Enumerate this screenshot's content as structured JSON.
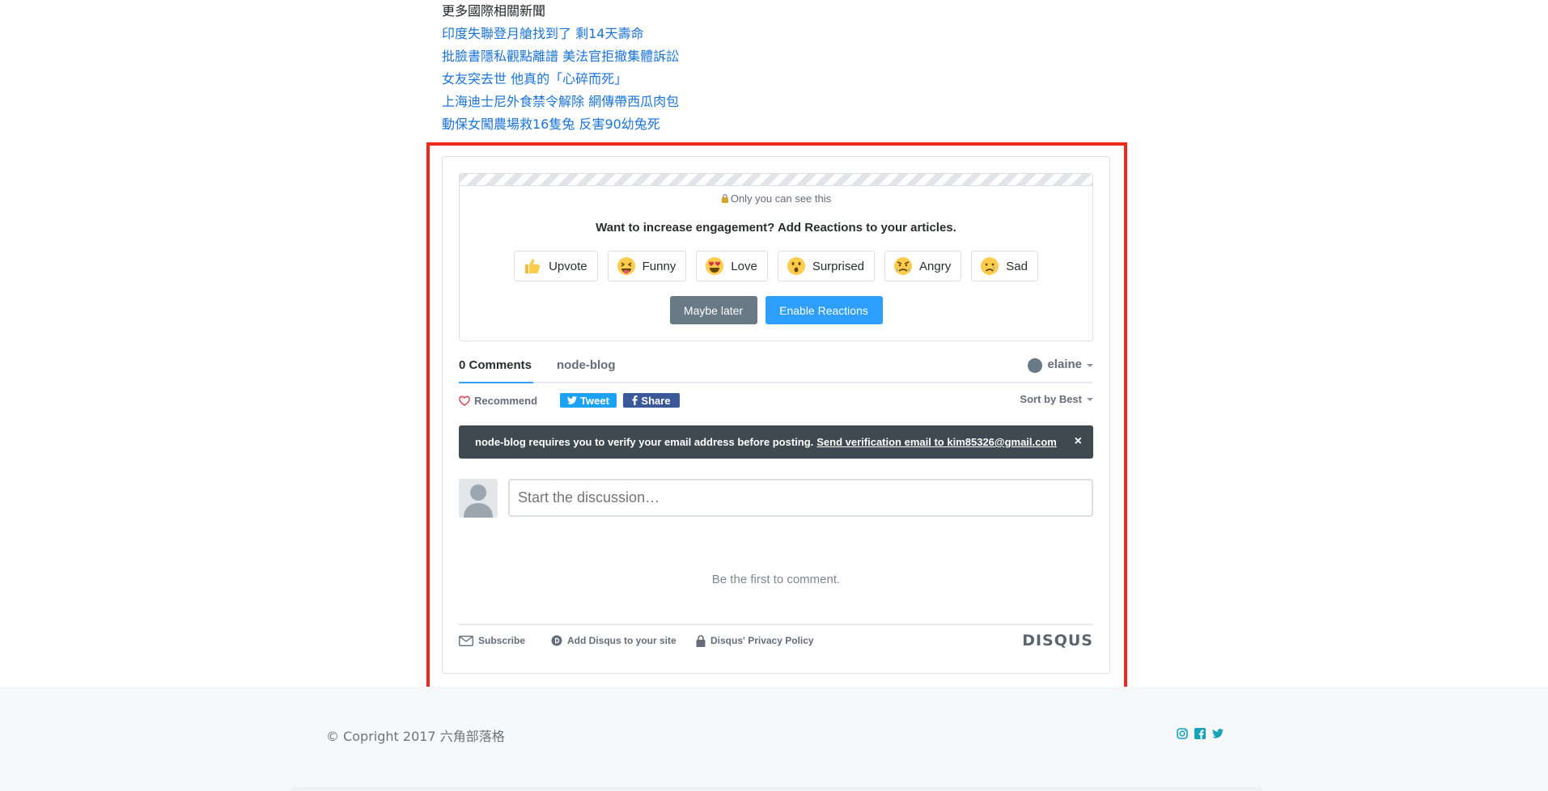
{
  "related": {
    "heading": "更多國際相關新聞",
    "links": [
      "印度失聯登月艙找到了 剩14天壽命",
      "批臉書隱私觀點離譜 美法官拒撤集體訴訟",
      "女友突去世 他真的「心碎而死」",
      "上海迪士尼外食禁令解除 網傳帶西瓜肉包",
      "動保女闖農場救16隻兔 反害90幼兔死"
    ]
  },
  "promo": {
    "only_you": "Only you can see this",
    "title": "Want to increase engagement? Add Reactions to your articles.",
    "reactions": [
      "Upvote",
      "Funny",
      "Love",
      "Surprised",
      "Angry",
      "Sad"
    ],
    "maybe_later": "Maybe later",
    "enable": "Enable Reactions"
  },
  "tabs": {
    "comments": "0 Comments",
    "forum": "node-blog",
    "user": "elaine"
  },
  "actions": {
    "recommend": "Recommend",
    "tweet": "Tweet",
    "share": "Share",
    "sort": "Sort by Best"
  },
  "notice": {
    "text": "node-blog requires you to verify your email address before posting.",
    "link": "Send verification email to kim85326@gmail.com",
    "close": "×"
  },
  "composer": {
    "placeholder": "Start the discussion…"
  },
  "empty_message": "Be the first to comment.",
  "dq_footer": {
    "subscribe": "Subscribe",
    "add_disqus": "Add Disqus to your site",
    "privacy": "Disqus' Privacy Policy",
    "logo": "DISQUS"
  },
  "page_footer": {
    "copyright": "© Copright 2017 六角部落格",
    "socials": [
      "instagram-icon",
      "facebook-icon",
      "twitter-icon"
    ],
    "social_color": "#17a2b8"
  },
  "colors": {
    "link": "#1a73d9",
    "accent": "#2e9fff",
    "highlight": "#ee2a1a",
    "notice_bg": "#3e4a4f"
  }
}
